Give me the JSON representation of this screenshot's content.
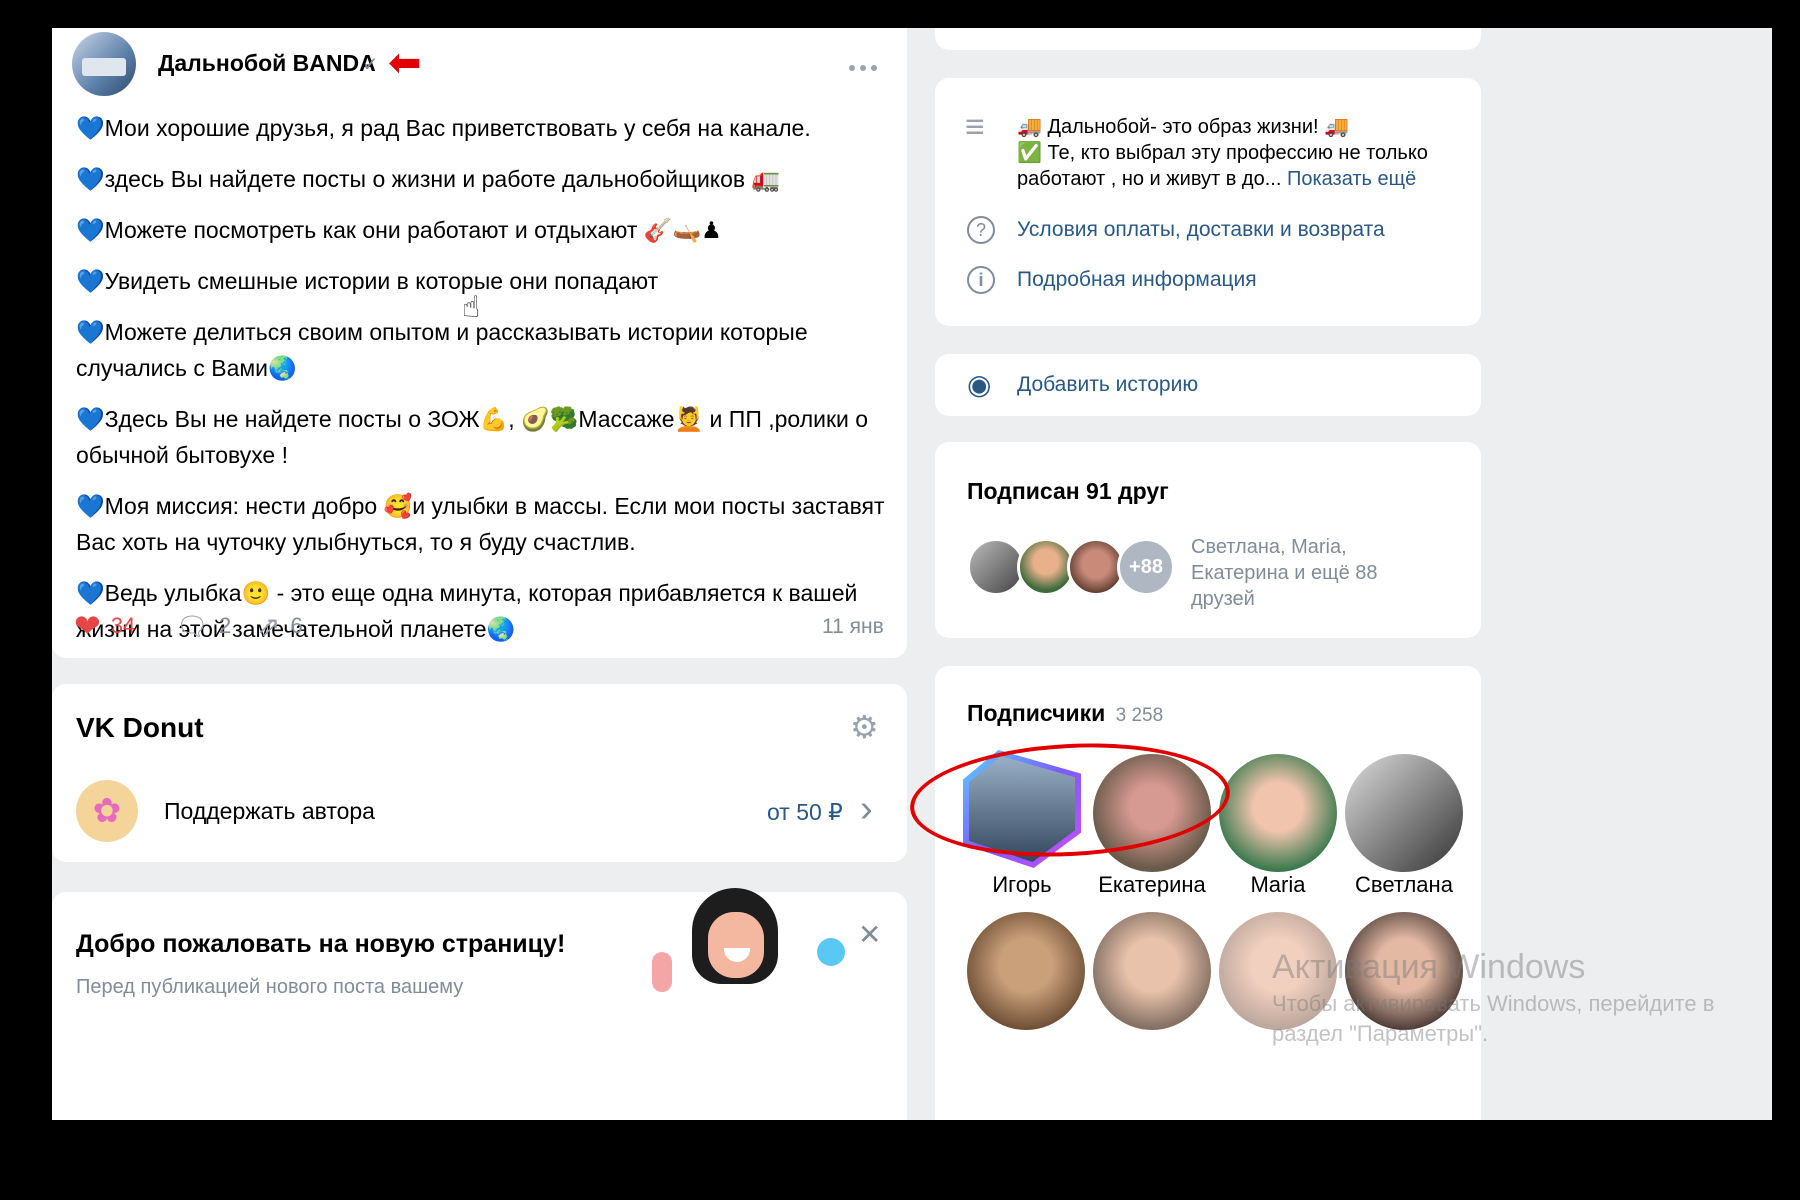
{
  "post": {
    "author": "Дальнобой BANDA",
    "verified_mark": "✓",
    "arrow_mark": "⬅",
    "menu_dots": "•••",
    "heart_emoji": "💙",
    "paragraphs": [
      "Мои хорошие друзья, я рад Вас приветствовать у себя на канале.",
      "здесь Вы найдете посты о жизни и работе дальнобойщиков 🚛",
      "Можете посмотреть как они работают и отдыхают 🎸🛶♟",
      "Увидеть смешные истории в которые они попадают",
      "Можете делиться своим опытом и рассказывать истории которые случались с Вами🌏",
      "Здесь Вы не найдете посты о ЗОЖ💪, 🥑🥦Массаже💆 и ПП ,ролики о обычной бытовухе !",
      "Моя миссия: нести добро 🥰и улыбки в массы. Если мои посты заставят Вас хоть на чуточку улыбнуться, то я буду счастлив.",
      "Ведь улыбка🙂 - это еще одна минута, которая прибавляется к вашей жизни на этой замечательной планете🌏"
    ],
    "likes": "34",
    "comments": "2",
    "shares": "6",
    "date": "11 янв",
    "icons": {
      "like": "❤",
      "comment": "🗨",
      "share": "⇗"
    }
  },
  "donut": {
    "title": "VK Donut",
    "settings_icon": "⚙",
    "support_label": "Поддержать автора",
    "price": "от 50 ₽",
    "chevron": "›",
    "badge": "✿"
  },
  "welcome": {
    "title": "Добро пожаловать на новую страницу!",
    "close": "✕",
    "subtitle": "Перед публикацией нового поста вашему"
  },
  "info": {
    "menu_icon": "≡",
    "line1": "🚚 Дальнобой- это образ жизни! 🚚",
    "line2": "✅ Те, кто выбрал эту профессию не только работают , но и живут в до...",
    "show_more": "Показать ещё",
    "terms_icon": "?",
    "terms": "Условия оплаты, доставки и возврата",
    "details_icon": "i",
    "details": "Подробная информация"
  },
  "story": {
    "icon": "◉",
    "label": "Добавить историю"
  },
  "friends": {
    "title": "Подписан 91 друг",
    "more_badge": "+88",
    "names": "Светлана, Maria, Екатерина и ещё 88 друзей"
  },
  "subscribers": {
    "title": "Подписчики",
    "count": "3 258",
    "people": [
      {
        "name": "Игорь"
      },
      {
        "name": "Екатерина"
      },
      {
        "name": "Maria"
      },
      {
        "name": "Светлана"
      }
    ]
  },
  "watermark": {
    "line1": "Активация Windows",
    "line2": "Чтобы активировать Windows, перейдите в",
    "line3": "раздел \"Параметры\"."
  },
  "colors": {
    "accent": "#2a5885",
    "like": "#e64646",
    "annotation": "#e00000",
    "bg": "#edeef0"
  }
}
